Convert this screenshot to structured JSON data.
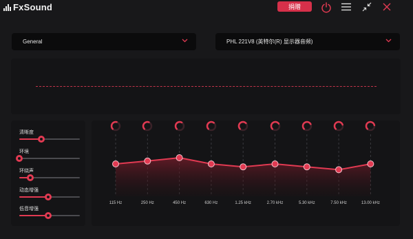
{
  "app": {
    "title": "FxSound"
  },
  "titlebar": {
    "sponsor_label": "捐赠",
    "power_icon": "power-icon",
    "menu_icon": "hamburger-menu-icon",
    "minimize_icon": "collapse-arrows-icon",
    "close_icon": "close-icon"
  },
  "preset": {
    "value": "General"
  },
  "output_device": {
    "value": "PHL 221V8 (英特尔(R) 显示器音频)"
  },
  "effects": [
    {
      "label": "清晰度",
      "level": 0.36
    },
    {
      "label": "环境",
      "level": 0.0
    },
    {
      "label": "环绕声",
      "level": 0.18
    },
    {
      "label": "动态增强",
      "level": 0.48
    },
    {
      "label": "低音增强",
      "level": 0.48
    }
  ],
  "equalizer": {
    "bands": [
      {
        "freq": "115 Hz",
        "gain": 0.0
      },
      {
        "freq": "250 Hz",
        "gain": 0.35
      },
      {
        "freq": "450 Hz",
        "gain": 0.75
      },
      {
        "freq": "630 Hz",
        "gain": 0.0
      },
      {
        "freq": "1.25 kHz",
        "gain": -0.35
      },
      {
        "freq": "2.70 kHz",
        "gain": 0.0
      },
      {
        "freq": "5.30 kHz",
        "gain": -0.35
      },
      {
        "freq": "7.50 kHz",
        "gain": -0.7
      },
      {
        "freq": "13.00 kHz",
        "gain": 0.0
      }
    ]
  },
  "colors": {
    "accent": "#e23a52",
    "background": "#18181a",
    "panel": "#141416"
  }
}
